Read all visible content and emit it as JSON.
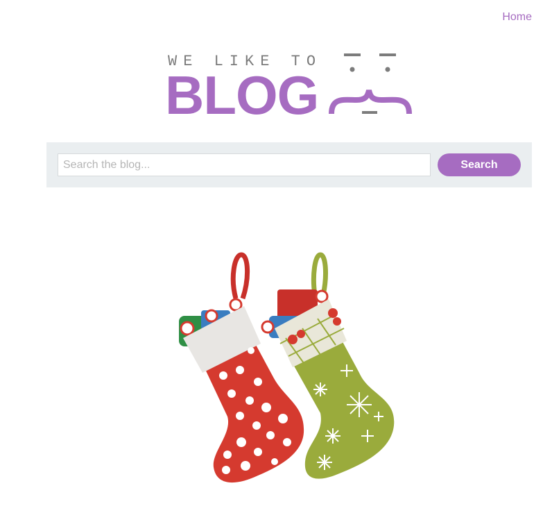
{
  "nav": {
    "home_label": "Home"
  },
  "logo": {
    "tagline": "WE LIKE TO",
    "wordmark": "BLOG",
    "brand_color": "#a66cc1",
    "tagline_color": "#7c7c7c"
  },
  "search": {
    "placeholder": "Search the blog...",
    "value": "",
    "button_label": "Search",
    "bar_color": "#eaeef0"
  },
  "hero": {
    "image": "christmas-stockings",
    "colors": {
      "red_stocking": "#d53a2f",
      "green_stocking": "#9aab3c"
    }
  }
}
